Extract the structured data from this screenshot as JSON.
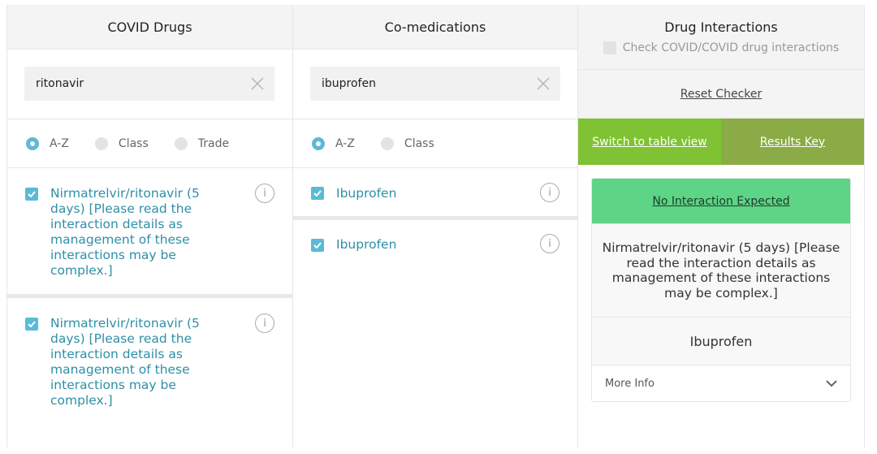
{
  "covid_drugs": {
    "title": "COVID Drugs",
    "search_value": "ritonavir",
    "radio": {
      "az": "A-Z",
      "class": "Class",
      "trade": "Trade"
    },
    "items": [
      {
        "label": "Nirmatrelvir/ritonavir (5 days) [Please read the interaction details as management of these interactions may be complex.]"
      },
      {
        "label": "Nirmatrelvir/ritonavir (5 days) [Please read the interaction details as management of these interactions may be complex.]"
      }
    ]
  },
  "comedications": {
    "title": "Co-medications",
    "search_value": "ibuprofen",
    "radio": {
      "az": "A-Z",
      "class": "Class"
    },
    "items": [
      {
        "label": "Ibuprofen"
      },
      {
        "label": "Ibuprofen"
      }
    ]
  },
  "interactions": {
    "title": "Drug Interactions",
    "check_label": "Check COVID/COVID drug interactions",
    "reset_label": "Reset Checker",
    "switch_label": "Switch to table view",
    "key_label": "Results Key",
    "result": {
      "status": "No Interaction Expected",
      "drug1": "Nirmatrelvir/ritonavir (5 days) [Please read the interaction details as management of these interactions may be complex.]",
      "drug2": "Ibuprofen",
      "more_info": "More Info"
    }
  },
  "colors": {
    "accent_teal": "#5bbad5",
    "drug_text": "#2f8fa7",
    "switch_green": "#7fc233",
    "key_green": "#8aab45",
    "no_interaction_green": "#5dd486"
  },
  "info_glyph": "i"
}
